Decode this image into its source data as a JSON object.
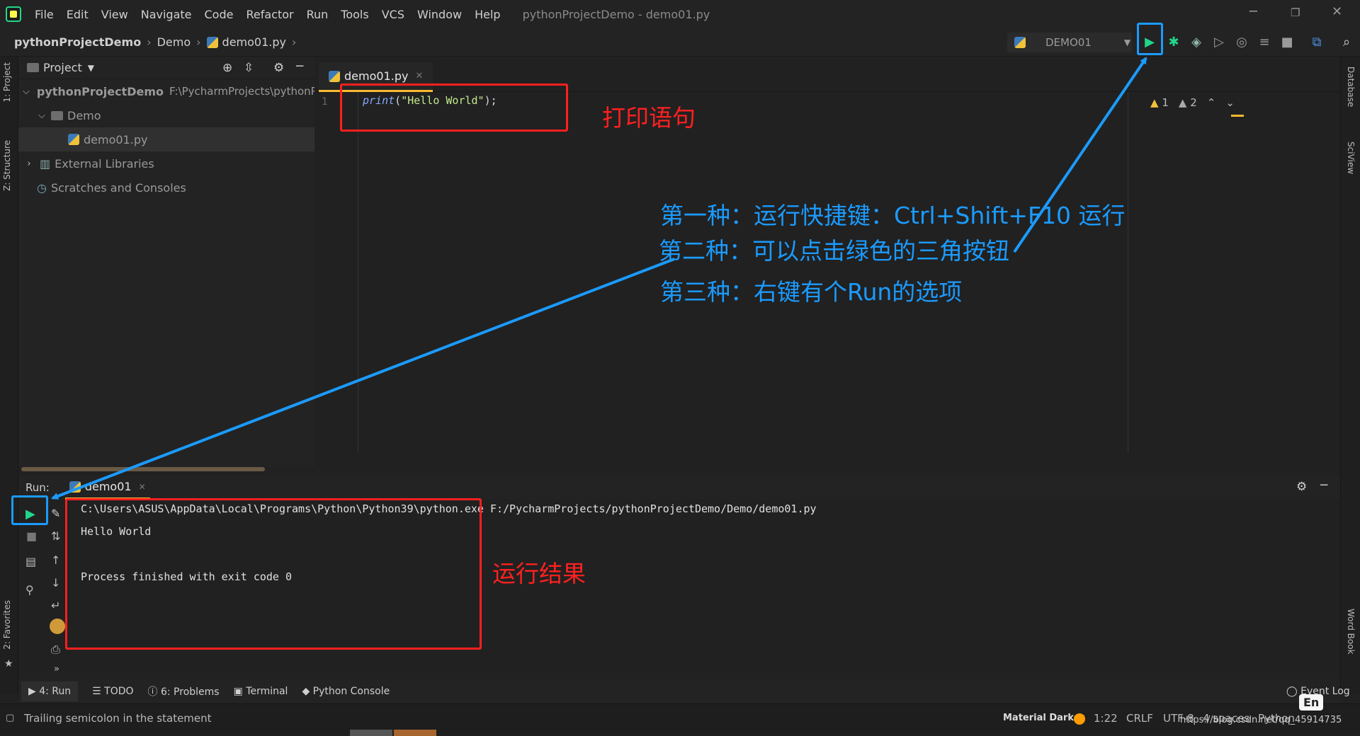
{
  "menubar": {
    "items": [
      "File",
      "Edit",
      "View",
      "Navigate",
      "Code",
      "Refactor",
      "Run",
      "Tools",
      "VCS",
      "Window",
      "Help"
    ],
    "title": "pythonProjectDemo - demo01.py"
  },
  "breadcrumbs": {
    "project": "pythonProjectDemo",
    "folder": "Demo",
    "file": "demo01.py"
  },
  "toolbar": {
    "run_config": "DEMO01"
  },
  "left_stripe": {
    "project": "1: Project",
    "structure": "Z: Structure",
    "favorites": "2: Favorites"
  },
  "right_stripe": {
    "database": "Database",
    "sciview": "SciView",
    "wordbook": "Word Book"
  },
  "project_panel": {
    "title": "Project",
    "tree": [
      {
        "label": "pythonProjectDemo",
        "extra": "F:\\PycharmProjects\\pythonP"
      },
      {
        "label": "Demo"
      },
      {
        "label": "demo01.py"
      },
      {
        "label": "External Libraries"
      },
      {
        "label": "Scratches and Consoles"
      }
    ]
  },
  "editor": {
    "tab": "demo01.py",
    "line_number": "1",
    "code": {
      "fn": "print",
      "paren_open": "(",
      "string": "\"Hello World\"",
      "paren_close": ");"
    },
    "warnings": "1",
    "weak_warnings": "2"
  },
  "annotations": {
    "print_stmt": "打印语句",
    "method1": "第一种：运行快捷键：Ctrl+Shift+F10 运行",
    "method2": "第二种：可以点击绿色的三角按钮",
    "method3": "第三种：右键有个Run的选项",
    "result": "运行结果"
  },
  "run_panel": {
    "label": "Run:",
    "tab": "demo01",
    "console": [
      "C:\\Users\\ASUS\\AppData\\Local\\Programs\\Python\\Python39\\python.exe F:/PycharmProjects/pythonProjectDemo/Demo/demo01.py",
      "Hello World",
      "",
      "Process finished with exit code 0"
    ]
  },
  "bottom_tabs": {
    "run": "4: Run",
    "todo": "TODO",
    "problems": "6: Problems",
    "terminal": "Terminal",
    "python_console": "Python Console",
    "event_log": "Event Log"
  },
  "statusbar": {
    "message": "Trailing semicolon in the statement",
    "theme": "Material Darker",
    "position": "1:22",
    "line_sep": "CRLF",
    "encoding": "UTF-8",
    "indent": "4 spaces",
    "interpreter": "Python",
    "ime": "En",
    "watermark": "https://blog.csdn.net/qq_45914735"
  },
  "colors": {
    "accent": "#fcb92e",
    "run_green": "#21d789",
    "annotation_red": "#ff2020",
    "annotation_blue": "#1b9bff"
  }
}
